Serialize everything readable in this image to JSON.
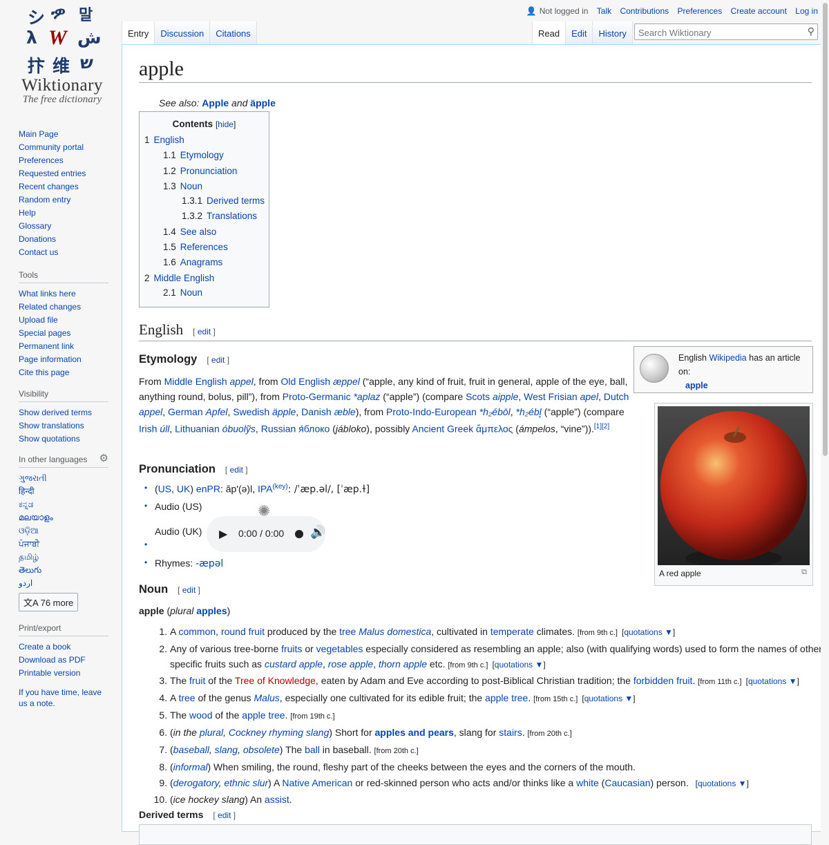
{
  "logo": {
    "wordmark": "Wiktionary",
    "tagline": "The free dictionary"
  },
  "personal": {
    "not_logged_in": "Not logged in",
    "items": [
      "Talk",
      "Contributions",
      "Preferences",
      "Create account",
      "Log in"
    ]
  },
  "tabs_left": [
    "Entry",
    "Discussion",
    "Citations"
  ],
  "tabs_right": [
    "Read",
    "Edit",
    "History"
  ],
  "search": {
    "placeholder": "Search Wiktionary"
  },
  "nav": {
    "items": [
      "Main Page",
      "Community portal",
      "Preferences",
      "Requested entries",
      "Recent changes",
      "Random entry",
      "Help",
      "Glossary",
      "Donations",
      "Contact us"
    ]
  },
  "tools": {
    "heading": "Tools",
    "items": [
      "What links here",
      "Related changes",
      "Upload file",
      "Special pages",
      "Permanent link",
      "Page information",
      "Cite this page"
    ]
  },
  "visibility": {
    "heading": "Visibility",
    "items": [
      "Show derived terms",
      "Show translations",
      "Show quotations"
    ]
  },
  "languages": {
    "heading": "In other languages",
    "items": [
      "ગુજરાતી",
      "हिन्दी",
      "ಕನ್ನಡ",
      "മലയാളം",
      "ଓଡ଼ିଆ",
      "ਪੰਜਾਬੀ",
      "தமிழ்",
      "తెలుగు",
      "اردو"
    ],
    "more": "76 more"
  },
  "print": {
    "heading": "Print/export",
    "items": [
      "Create a book",
      "Download as PDF",
      "Printable version"
    ]
  },
  "note": "If you have time, leave us a note.",
  "page": {
    "title": "apple",
    "see_also_label": "See also:",
    "see_also_1": "Apple",
    "see_also_and": "and",
    "see_also_2": "äpple"
  },
  "toc": {
    "title": "Contents",
    "hide": "hide",
    "entries": [
      {
        "num": "1",
        "label": "English"
      },
      {
        "num": "1.1",
        "label": "Etymology"
      },
      {
        "num": "1.2",
        "label": "Pronunciation"
      },
      {
        "num": "1.3",
        "label": "Noun"
      },
      {
        "num": "1.3.1",
        "label": "Derived terms"
      },
      {
        "num": "1.3.2",
        "label": "Translations"
      },
      {
        "num": "1.4",
        "label": "See also"
      },
      {
        "num": "1.5",
        "label": "References"
      },
      {
        "num": "1.6",
        "label": "Anagrams"
      },
      {
        "num": "2",
        "label": "Middle English"
      },
      {
        "num": "2.1",
        "label": "Noun"
      }
    ]
  },
  "sections": {
    "english": "English",
    "etymology": "Etymology",
    "pronunciation": "Pronunciation",
    "noun": "Noun",
    "derived": "Derived terms",
    "edit": "edit"
  },
  "wikipedia_box": {
    "prefix": "English",
    "link": "Wikipedia",
    "suffix": "has an article on:",
    "article": "apple"
  },
  "image": {
    "caption": "A red apple"
  },
  "pronunciation": {
    "accent_open": "(",
    "us": "US",
    "uk": "UK",
    "accent_close": ")",
    "enpr_label": "enPR",
    "enpr": ": ăp'(ə)l,",
    "ipa_label": "IPA",
    "key": "(key)",
    "ipa": ": /ˈæp.əl/, [ˈæp.ɫ]",
    "audio_us": "Audio (US)",
    "audio_uk": "Audio (UK)",
    "audio_time": "0:00 / 0:00",
    "rhymes_label": "Rhymes:",
    "rhymes": "-æpəl"
  },
  "noun": {
    "headword": "apple",
    "plural_label": "plural",
    "plural": "apples"
  }
}
